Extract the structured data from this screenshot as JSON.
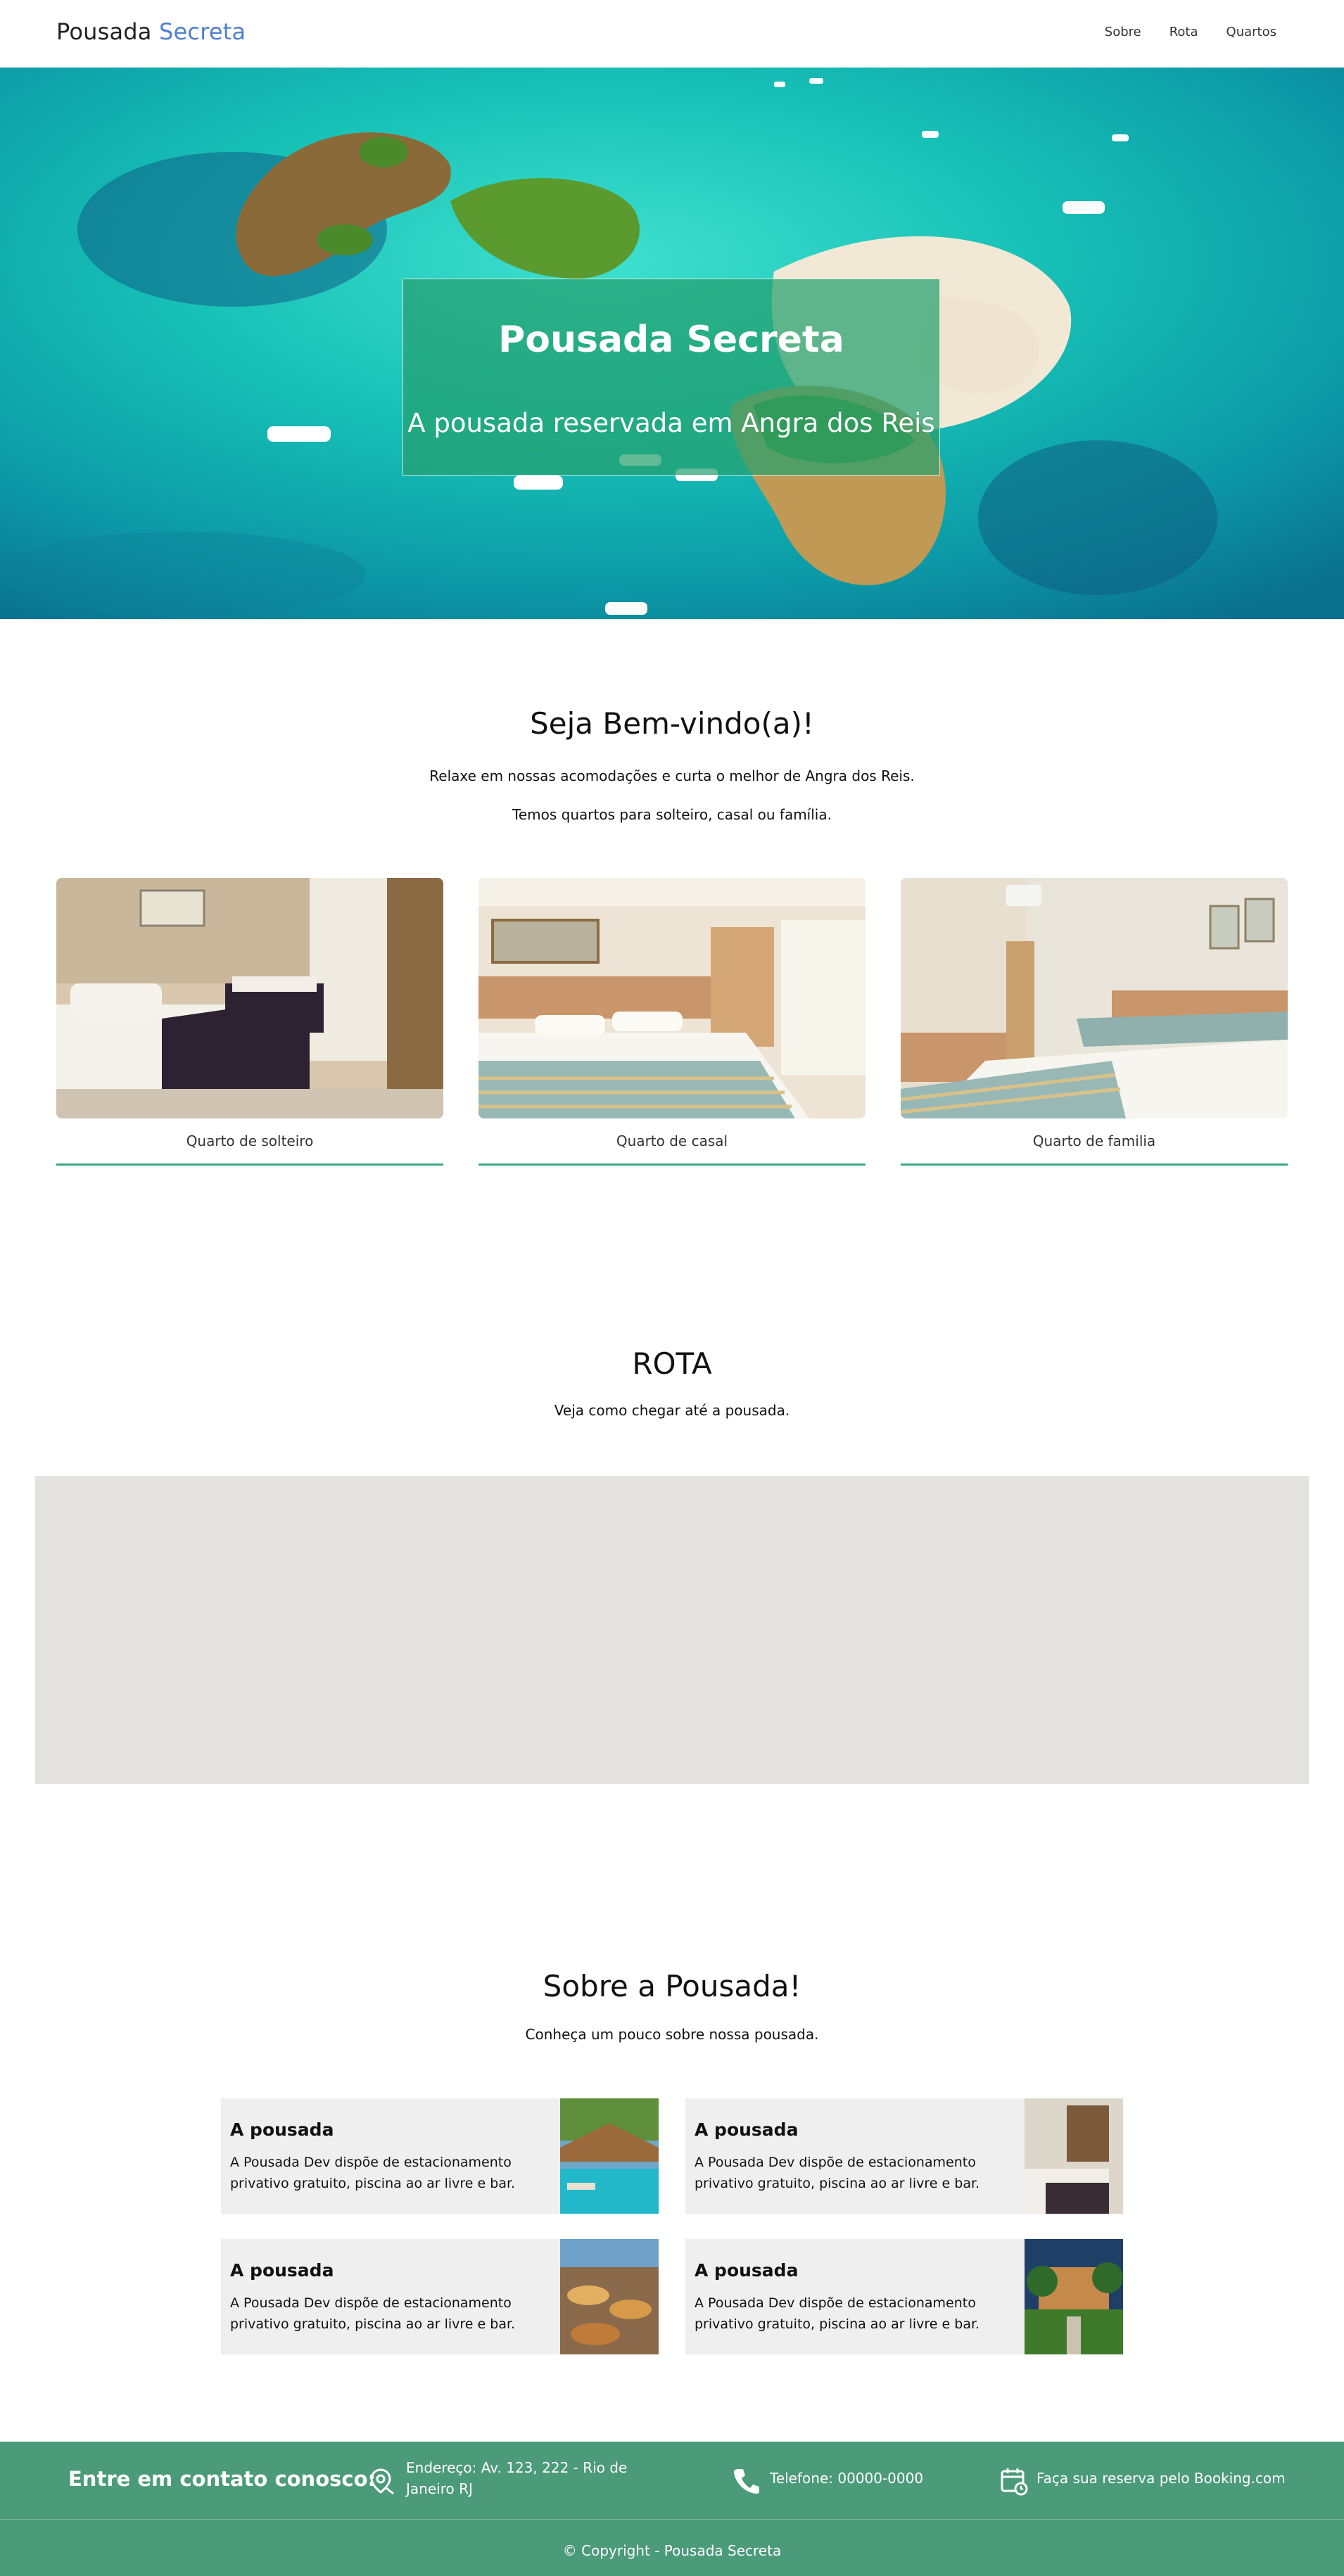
{
  "header": {
    "logo_main": "Pousada",
    "logo_accent": "Secreta",
    "nav": [
      {
        "label": "Sobre"
      },
      {
        "label": "Rota"
      },
      {
        "label": "Quartos"
      }
    ]
  },
  "hero": {
    "title": "Pousada Secreta",
    "subtitle": "A pousada reservada em Angra dos Reis"
  },
  "welcome": {
    "title": "Seja Bem-vindo(a)!",
    "text1": "Relaxe em nossas acomodações e curta o melhor de Angra dos Reis.",
    "text2": "Temos quartos para solteiro, casal ou família.",
    "rooms": [
      {
        "caption": "Quarto de solteiro"
      },
      {
        "caption": "Quarto de casal"
      },
      {
        "caption": "Quarto de familia"
      }
    ]
  },
  "route": {
    "title": "ROTA",
    "text": "Veja como chegar até a pousada."
  },
  "about": {
    "title": "Sobre a Pousada!",
    "text": "Conheça um pouco sobre nossa pousada.",
    "cards": [
      {
        "title": "A pousada",
        "desc": "A Pousada Dev dispõe de estacionamento privativo gratuito, piscina ao ar livre e bar."
      },
      {
        "title": "A pousada",
        "desc": "A Pousada Dev dispõe de estacionamento privativo gratuito, piscina ao ar livre e bar."
      },
      {
        "title": "A pousada",
        "desc": "A Pousada Dev dispõe de estacionamento privativo gratuito, piscina ao ar livre e bar."
      },
      {
        "title": "A pousada",
        "desc": "A Pousada Dev dispõe de estacionamento privativo gratuito, piscina ao ar livre e bar."
      }
    ]
  },
  "footer": {
    "contact_title": "Entre em contato conosco:",
    "address_line1": "Endereço: Av. 123, 222 - Rio de",
    "address_line2": "Janeiro RJ",
    "phone": "Telefone: 00000-0000",
    "booking": "Faça sua reserva pelo Booking.com",
    "copyright": "© Copyright - Pousada Secreta"
  },
  "colors": {
    "accent_blue": "#4f7fd1",
    "accent_green": "#3aa783",
    "footer_green": "#4b9a7a",
    "map_gray": "#e5e3df"
  }
}
